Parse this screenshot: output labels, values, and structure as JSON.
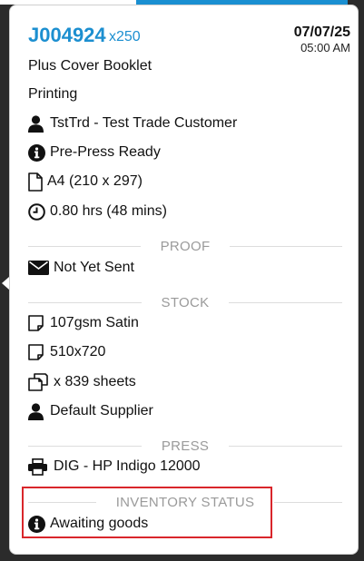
{
  "job": {
    "number": "J004924",
    "quantity": "x250",
    "date": "07/07/25",
    "time": "05:00 AM",
    "product": "Plus Cover Booklet",
    "stage": "Printing",
    "customer": "TstTrd - Test Trade Customer",
    "status": "Pre-Press Ready",
    "size": "A4 (210 x 297)",
    "duration": "0.80 hrs (48 mins)"
  },
  "proof": {
    "heading": "PROOF",
    "status": "Not Yet Sent"
  },
  "stock": {
    "heading": "STOCK",
    "paper": "107gsm Satin",
    "sheet_size": "510x720",
    "sheets": "x 839 sheets",
    "supplier": "Default Supplier"
  },
  "press": {
    "heading": "PRESS",
    "machine": "DIG - HP Indigo 12000"
  },
  "inventory": {
    "heading": "INVENTORY STATUS",
    "status": "Awaiting goods"
  },
  "colors": {
    "accent": "#1c8fd0",
    "highlight": "#d9262b"
  },
  "icons": {
    "customer": "user-icon",
    "status": "info-icon",
    "size": "file-icon",
    "duration": "clock-icon",
    "proof": "envelope-icon",
    "paper": "sheet-icon",
    "sheet_size": "sheet-icon",
    "sheets": "copy-icon",
    "supplier": "user-icon",
    "press": "printer-icon",
    "inventory": "info-icon"
  }
}
